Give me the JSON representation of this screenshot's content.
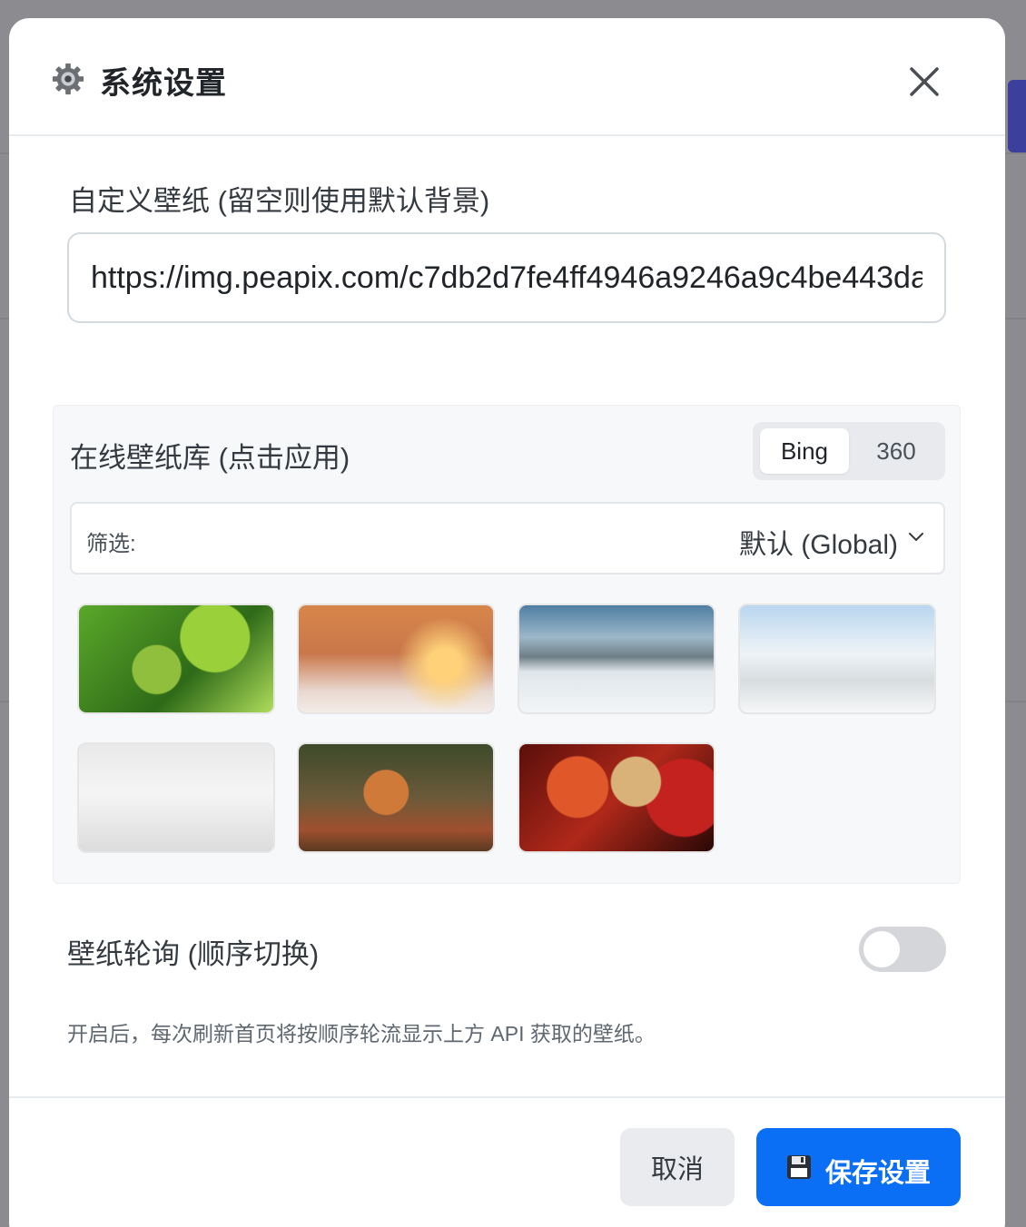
{
  "modal": {
    "title": "系统设置",
    "icon": "gear-icon",
    "close_icon": "close-icon"
  },
  "custom_wallpaper": {
    "label": "自定义壁纸 (留空则使用默认背景)",
    "value": "https://img.peapix.com/c7db2d7fe4ff4946a9246a9c4be443da"
  },
  "gallery": {
    "title": "在线壁纸库 (点击应用)",
    "sources": [
      {
        "label": "Bing",
        "active": true
      },
      {
        "label": "360",
        "active": false
      }
    ],
    "filter": {
      "label": "筛选:",
      "selected": "默认 (Global)"
    },
    "thumbnails": [
      {
        "subject": "parrot-in-green-leaves"
      },
      {
        "subject": "sunset-snowy-forest"
      },
      {
        "subject": "snowy-mountain-lake"
      },
      {
        "subject": "frosted-trees-pavilion"
      },
      {
        "subject": "swans-on-snow"
      },
      {
        "subject": "fox-in-autumn-foliage"
      },
      {
        "subject": "paper-star-lanterns"
      }
    ]
  },
  "rotation": {
    "label": "壁纸轮询 (顺序切换)",
    "enabled": false,
    "hint": "开启后，每次刷新首页将按顺序轮流显示上方 API 获取的壁纸。"
  },
  "footer": {
    "cancel_label": "取消",
    "save_label": "保存设置",
    "save_icon": "floppy-disk-icon",
    "save_color": "#0b6ff5"
  }
}
